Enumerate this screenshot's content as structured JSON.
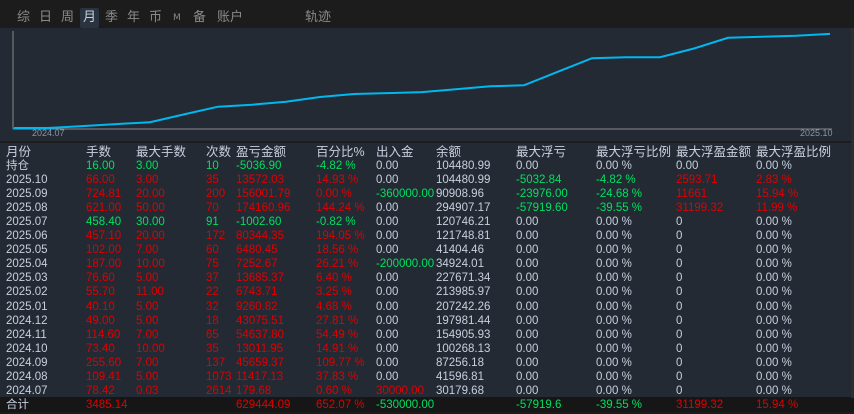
{
  "tabs": [
    "综",
    "日",
    "周",
    "月",
    "季",
    "年",
    "币",
    "M",
    "备",
    "账户",
    "轨迹"
  ],
  "active_tab": "月",
  "chart_data": {
    "type": "line",
    "x_start_label": "2024.07",
    "x_end_label": "2025.10",
    "series": [
      {
        "name": "equity",
        "color": "#00b8f0",
        "values": [
          0,
          0,
          2,
          4,
          6,
          14,
          22,
          24,
          27,
          32,
          35,
          36,
          37,
          40,
          43,
          44,
          58,
          72,
          73,
          73,
          82,
          93,
          94,
          95,
          97
        ]
      }
    ],
    "ylim": [
      0,
      100
    ]
  },
  "table": {
    "headers": [
      "月份",
      "手数",
      "最大手数",
      "次数",
      "盈亏金额",
      "百分比%",
      "出入金",
      "余额",
      "最大浮亏",
      "最大浮亏比例",
      "最大浮盈金额",
      "最大浮盈比例"
    ],
    "rows": [
      {
        "cells": [
          "持仓",
          "16.00",
          "3.00",
          "10",
          "-5036.90",
          "-4.82 %",
          "0.00",
          "104480.99",
          "0.00",
          "0.00 %",
          "0.00",
          "0.00 %"
        ],
        "tones": "wgggggwwwwww"
      },
      {
        "cells": [
          "2025.10",
          "66.00",
          "3.00",
          "35",
          "13572.03",
          "14.93 %",
          "0.00",
          "104480.99",
          "-5032.84",
          "-4.82 %",
          "2593.71",
          "2.83 %"
        ],
        "tones": "wrrrrrwwggrr"
      },
      {
        "cells": [
          "2025.09",
          "724.81",
          "20.00",
          "200",
          "156001.79",
          "0.00 %",
          "-360000.00",
          "90908.96",
          "-23976.00",
          "-24.68 %",
          "11661",
          "15.94 %"
        ],
        "tones": "wrrrrrgwggrr"
      },
      {
        "cells": [
          "2025.08",
          "621.00",
          "50.00",
          "70",
          "174160.96",
          "144.24 %",
          "0.00",
          "294907.17",
          "-57919.60",
          "-39.55 %",
          "31199.32",
          "11.99 %"
        ],
        "tones": "wrrrrrwwggrr"
      },
      {
        "cells": [
          "2025.07",
          "458.40",
          "30.00",
          "91",
          "-1002.60",
          "-0.82 %",
          "0.00",
          "120746.21",
          "0.00",
          "0.00 %",
          "0",
          "0.00 %"
        ],
        "tones": "wgggggwwwwww"
      },
      {
        "cells": [
          "2025.06",
          "457.10",
          "20.00",
          "172",
          "80344.35",
          "194.05 %",
          "0.00",
          "121748.81",
          "0.00",
          "0.00 %",
          "0",
          "0.00 %"
        ],
        "tones": "wrrrrrwwwwww"
      },
      {
        "cells": [
          "2025.05",
          "102.00",
          "7.00",
          "60",
          "6480.45",
          "18.56 %",
          "0.00",
          "41404.46",
          "0.00",
          "0.00 %",
          "0",
          "0.00 %"
        ],
        "tones": "wrrrrrwwwwww"
      },
      {
        "cells": [
          "2025.04",
          "187.00",
          "10.00",
          "75",
          "7252.67",
          "26.21 %",
          "-200000.00",
          "34924.01",
          "0.00",
          "0.00 %",
          "0",
          "0.00 %"
        ],
        "tones": "wrrrrrgwwwww"
      },
      {
        "cells": [
          "2025.03",
          "76.60",
          "5.00",
          "37",
          "13685.37",
          "6.40 %",
          "0.00",
          "227671.34",
          "0.00",
          "0.00 %",
          "0",
          "0.00 %"
        ],
        "tones": "wrrrrrwwwwww"
      },
      {
        "cells": [
          "2025.02",
          "55.70",
          "11.00",
          "22",
          "6743.71",
          "3.25 %",
          "0.00",
          "213985.97",
          "0.00",
          "0.00 %",
          "0",
          "0.00 %"
        ],
        "tones": "wrrrrrwwwwww"
      },
      {
        "cells": [
          "2025.01",
          "40.10",
          "5.00",
          "32",
          "9260.82",
          "4.68 %",
          "0.00",
          "207242.26",
          "0.00",
          "0.00 %",
          "0",
          "0.00 %"
        ],
        "tones": "wrrrrrwwwwww"
      },
      {
        "cells": [
          "2024.12",
          "49.00",
          "5.00",
          "18",
          "43075.51",
          "27.81 %",
          "0.00",
          "197981.44",
          "0.00",
          "0.00 %",
          "0",
          "0.00 %"
        ],
        "tones": "wrrrrrwwwwww"
      },
      {
        "cells": [
          "2024.11",
          "114.60",
          "7.00",
          "65",
          "54637.80",
          "54.49 %",
          "0.00",
          "154905.93",
          "0.00",
          "0.00 %",
          "0",
          "0.00 %"
        ],
        "tones": "wrrrrrwwwwww"
      },
      {
        "cells": [
          "2024.10",
          "73.40",
          "10.00",
          "35",
          "13011.95",
          "14.91 %",
          "0.00",
          "100268.13",
          "0.00",
          "0.00 %",
          "0",
          "0.00 %"
        ],
        "tones": "wrrrrrwwwwww"
      },
      {
        "cells": [
          "2024.09",
          "255.60",
          "7.00",
          "137",
          "45659.37",
          "109.77 %",
          "0.00",
          "87256.18",
          "0.00",
          "0.00 %",
          "0",
          "0.00 %"
        ],
        "tones": "wrrrrrwwwwww"
      },
      {
        "cells": [
          "2024.08",
          "109.41",
          "5.00",
          "1073",
          "11417.13",
          "37.83 %",
          "0.00",
          "41596.81",
          "0.00",
          "0.00 %",
          "0",
          "0.00 %"
        ],
        "tones": "wrrrrrwwwwww"
      },
      {
        "cells": [
          "2024.07",
          "78.42",
          "0.03",
          "2614",
          "179.68",
          "0.60 %",
          "30000.00",
          "30179.68",
          "0.00",
          "0.00 %",
          "0",
          "0.00 %"
        ],
        "tones": "wrrrrrrwwwww"
      }
    ],
    "total": {
      "cells": [
        "合计",
        "3485.14",
        "",
        "",
        "629444.09",
        "652.07 %",
        "-530000.00",
        "",
        "-57919.6",
        "-39.55 %",
        "31199.32",
        "15.94 %"
      ],
      "tones": "wrrrrrgwggrr"
    }
  }
}
